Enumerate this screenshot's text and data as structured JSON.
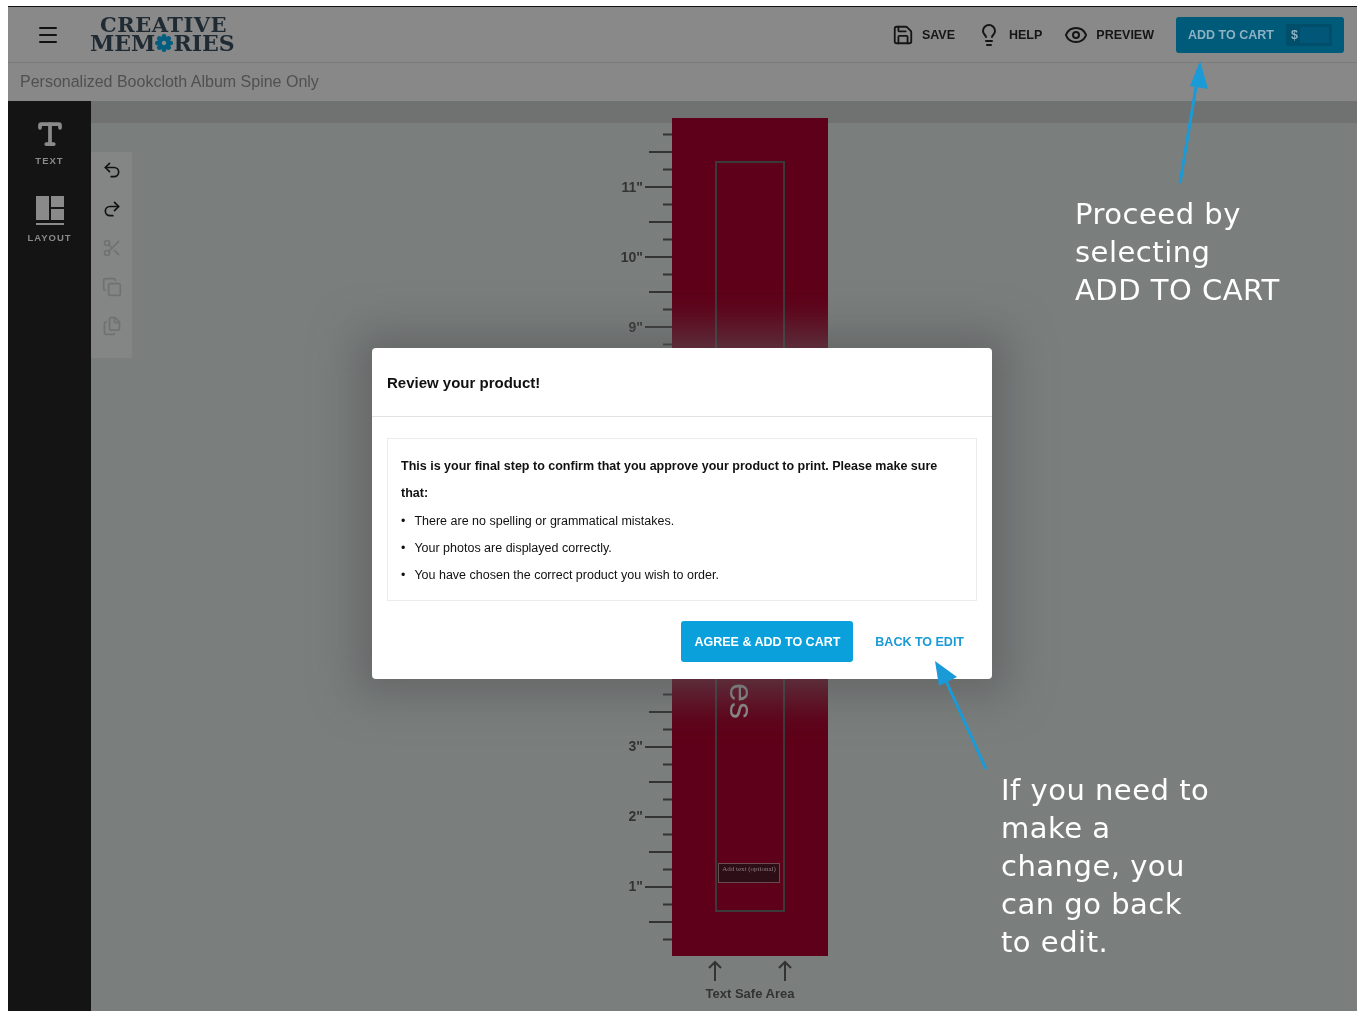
{
  "header": {
    "logo": {
      "top": "CREATIVE",
      "bottom_left": "MEM",
      "bottom_right": "RIES"
    },
    "actions": [
      {
        "kind": "save",
        "label": "SAVE"
      },
      {
        "kind": "help",
        "label": "HELP"
      },
      {
        "kind": "preview",
        "label": "PREVIEW"
      }
    ],
    "cart_button": {
      "label": "ADD TO CART",
      "price": "$"
    }
  },
  "product_title": "Personalized Bookcloth Album Spine Only",
  "sidebar": {
    "items": [
      {
        "kind": "text",
        "label": "TEXT"
      },
      {
        "kind": "layout",
        "label": "LAYOUT"
      }
    ]
  },
  "edit_tools": [
    {
      "kind": "undo",
      "disabled": false
    },
    {
      "kind": "redo",
      "disabled": false
    },
    {
      "kind": "cut",
      "disabled": true
    },
    {
      "kind": "copy",
      "disabled": true
    },
    {
      "kind": "paste",
      "disabled": true
    }
  ],
  "spine": {
    "ruler_upper": [
      "11\"",
      "10\"",
      "9\""
    ],
    "ruler_lower": [
      "3\"",
      "2\"",
      "1\""
    ],
    "text": "es",
    "placeholder": "Add text (optional)",
    "safe_area_label": "Text Safe Area"
  },
  "dialog": {
    "title": "Review your product!",
    "intro": "This is your final step to confirm that you approve your product to print. Please make sure that:",
    "bullets": [
      {
        "marker": "•",
        "text": "There are no spelling or grammatical mistakes."
      },
      {
        "marker": "•",
        "text": "Your photos are displayed correctly."
      },
      {
        "marker": "•",
        "text": "You have chosen the correct product you wish to order."
      }
    ],
    "primary_button": "AGREE & ADD TO CART",
    "secondary_button": "BACK TO EDIT"
  },
  "annotations": [
    {
      "kind": "cart",
      "text": "Proceed by selecting ADD TO CART"
    },
    {
      "kind": "edit",
      "text": "If you need to make a change, you can go back to edit."
    }
  ]
}
